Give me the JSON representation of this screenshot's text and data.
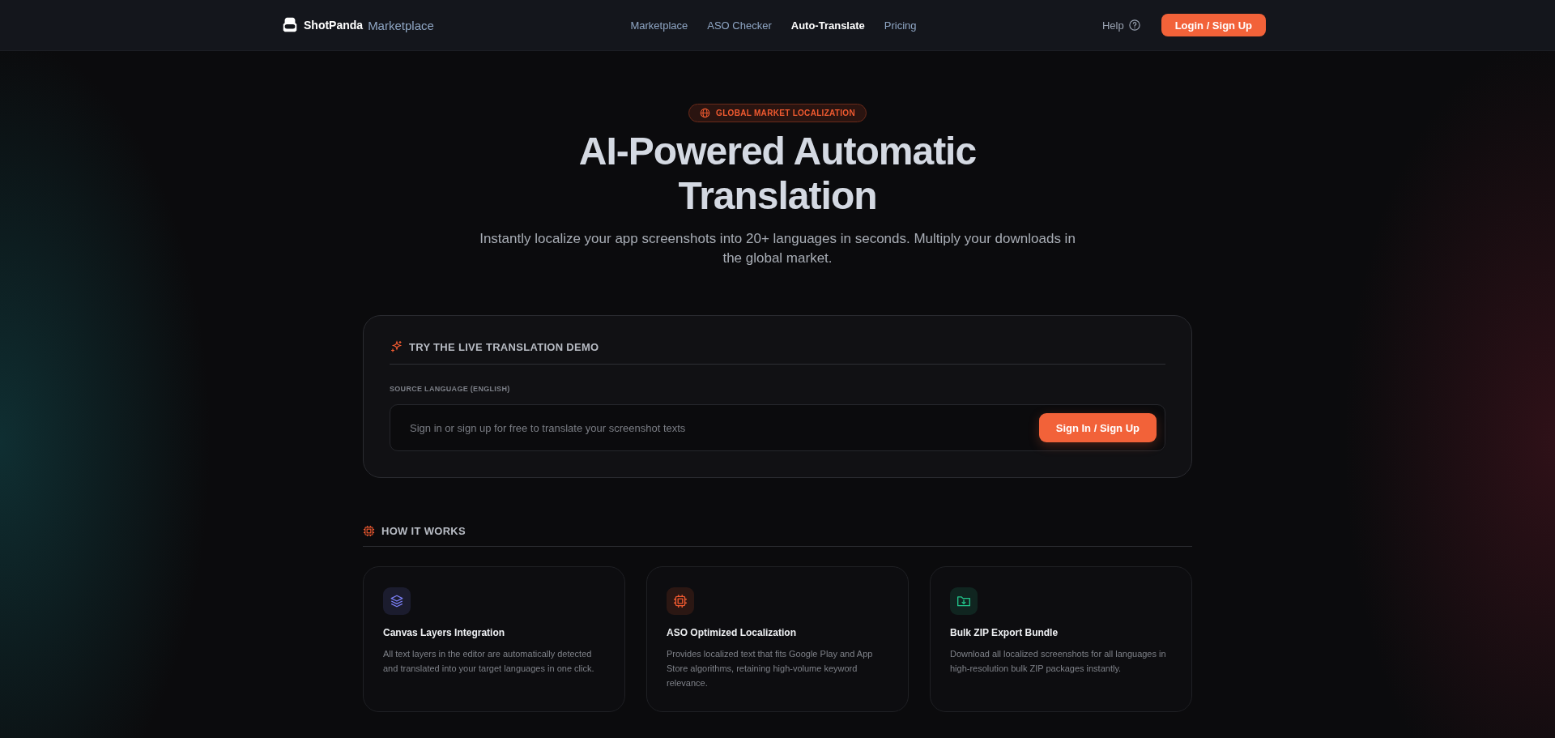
{
  "header": {
    "brand": "ShotPanda",
    "brand_suffix": "Marketplace",
    "nav": [
      {
        "label": "Marketplace",
        "selected": false
      },
      {
        "label": "ASO Checker",
        "selected": false
      },
      {
        "label": "Auto-Translate",
        "selected": true
      },
      {
        "label": "Pricing",
        "selected": false
      }
    ],
    "help": "Help",
    "login": "Login / Sign Up"
  },
  "hero": {
    "badge": "GLOBAL MARKET LOCALIZATION",
    "title_lines": [
      "AI-Powered Automatic",
      "Translation"
    ],
    "subtitle": "Instantly localize your app screenshots into 20+ languages in seconds. Multiply your downloads in the global market."
  },
  "demo": {
    "heading": "TRY THE LIVE TRANSLATION DEMO",
    "field_label": "SOURCE LANGUAGE (ENGLISH)",
    "placeholder": "Sign in or sign up for free to translate your screenshot texts",
    "button": "Sign In / Sign Up"
  },
  "how_it_works": {
    "heading": "HOW IT WORKS",
    "features": [
      {
        "kind": "layers",
        "color": "#7b7ff5",
        "title": "Canvas Layers Integration",
        "text": "All text layers in the editor are automatically detected and translated into your target languages in one click."
      },
      {
        "kind": "chip",
        "color": "#f05a30",
        "title": "ASO Optimized Localization",
        "text": "Provides localized text that fits Google Play and App Store algorithms, retaining high-volume keyword relevance."
      },
      {
        "kind": "folder",
        "color": "#22c58b",
        "title": "Bulk ZIP Export Bundle",
        "text": "Download all localized screenshots for all languages in high-resolution bulk ZIP packages instantly."
      }
    ]
  }
}
